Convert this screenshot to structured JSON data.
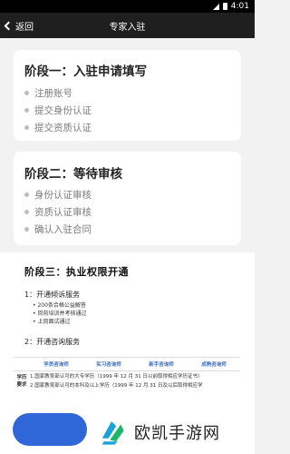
{
  "status_bar": {
    "time": "4:01"
  },
  "nav": {
    "back_label": "返回",
    "title": "专家入驻"
  },
  "stage1": {
    "title": "阶段一：入驻申请填写",
    "items": [
      "注册账号",
      "提交身份认证",
      "提交资质认证"
    ]
  },
  "stage2": {
    "title": "阶段二：等待审核",
    "items": [
      "身份认证审核",
      "资质认证审核",
      "确认入驻合同"
    ]
  },
  "stage3": {
    "title": "阶段三：执业权限开通",
    "section1": "1：开通倾诉服务",
    "section1_items": [
      "200条合格公益解答",
      "岗前培训并考核通过",
      "上岗面试通过"
    ],
    "section2": "2：开通咨询服务",
    "table": {
      "headers": [
        "学员咨询师",
        "实习咨询师",
        "新手咨询师",
        "成熟咨询师"
      ],
      "row_label": [
        "学历",
        "要求"
      ],
      "rows": [
        "1.国家教育部认可的大专学历（1999 年 12 月 31 日以前取得相应学历证书）",
        "2.国家教育部认可的本科及以上学历（1999 年 12 月 31 日及以后取得相应学"
      ]
    }
  },
  "watermark": {
    "text": "欧凯手游网"
  },
  "colors": {
    "accent": "#2f67d8",
    "table_header": "#3a6fc4",
    "nav_bg": "#1f1f1f"
  }
}
